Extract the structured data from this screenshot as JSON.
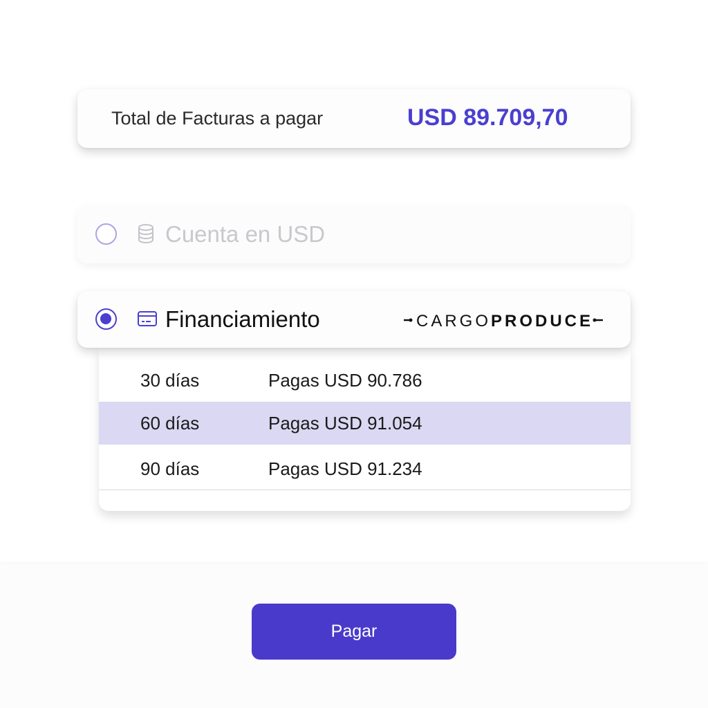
{
  "summary": {
    "total_label": "Total de Facturas a pagar",
    "total_amount": "USD 89.709,70"
  },
  "payment_options": [
    {
      "label": "Cuenta en USD",
      "icon": "coins-stack-icon",
      "selected": false
    },
    {
      "label": "Financiamiento",
      "icon": "credit-card-icon",
      "selected": true,
      "brand_logo": "CARGOPRODUCE"
    }
  ],
  "financing_plans": [
    {
      "days": "30 días",
      "price": "Pagas USD 90.786",
      "highlighted": false
    },
    {
      "days": "60 días",
      "price": "Pagas USD 91.054",
      "highlighted": true
    },
    {
      "days": "90 días",
      "price": "Pagas USD 91.234",
      "highlighted": false
    }
  ],
  "footer": {
    "pay_label": "Pagar"
  },
  "colors": {
    "accent": "#4a3fcf",
    "button": "#4a3acb",
    "highlight_row": "#dad8f2",
    "disabled_text": "#c8c8ce"
  }
}
